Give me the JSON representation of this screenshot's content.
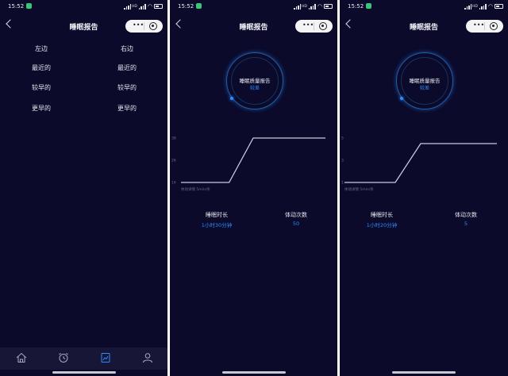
{
  "status": {
    "time": "15:52",
    "signal_tag": "HD"
  },
  "nav": {
    "title": "睡眠报告"
  },
  "screen1": {
    "left_header": "左边",
    "right_header": "右边",
    "rows": [
      {
        "left": "最近的",
        "right": "最近的"
      },
      {
        "left": "较早的",
        "right": "较早的"
      },
      {
        "left": "更早的",
        "right": "更早的"
      }
    ]
  },
  "tabbar": {
    "icons": [
      "home-icon",
      "alarm-clock-icon",
      "report-icon",
      "user-icon"
    ],
    "active": 2,
    "active_color": "#2d8cff"
  },
  "screen2": {
    "quality_label": "睡眠质量报告",
    "quality_value": "较差",
    "stats": {
      "duration_label": "睡眠时长",
      "duration_value": "1小时30分钟",
      "moves_label": "体动次数",
      "moves_value": "50"
    }
  },
  "screen3": {
    "quality_label": "睡眠质量报告",
    "quality_value": "较差",
    "stats": {
      "duration_label": "睡眠时长",
      "duration_value": "1小时20分钟",
      "moves_label": "体动次数",
      "moves_value": "5"
    }
  },
  "chart_data": [
    {
      "type": "line",
      "yticks": [
        "14",
        "26",
        "38"
      ],
      "ylim": [
        14,
        38
      ],
      "xlabel": "体动详情  5min/条",
      "x": [
        0,
        1,
        2,
        3,
        4,
        5,
        6
      ],
      "y": [
        14,
        14,
        14,
        38,
        38,
        38,
        38
      ],
      "line_color": "#c9c9dd",
      "grid": false
    },
    {
      "type": "line",
      "yticks": [
        "1",
        "3",
        "5"
      ],
      "ylim": [
        1,
        5
      ],
      "xlabel": "体动详情  5min/条",
      "x": [
        0,
        1,
        2,
        3,
        4,
        5,
        6
      ],
      "y": [
        1,
        1,
        1,
        4.5,
        4.5,
        4.5,
        4.5
      ],
      "line_color": "#c9c9dd",
      "grid": false
    }
  ]
}
